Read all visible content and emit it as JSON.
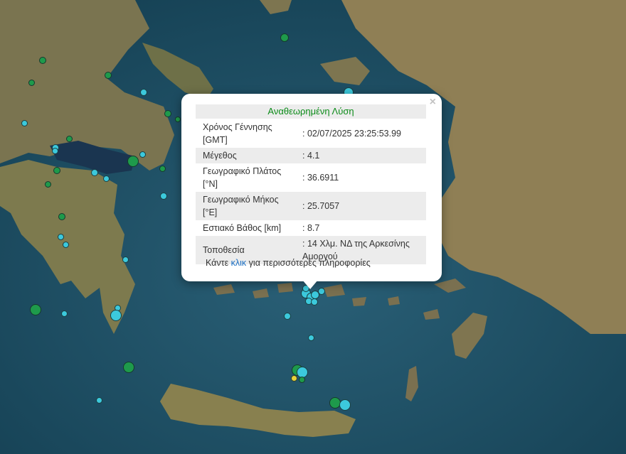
{
  "popup": {
    "header": "Αναθεωρημένη Λύση",
    "close_symbol": "×",
    "rows": [
      {
        "label": "Χρόνος Γέννησης [GMT]",
        "value": ": 02/07/2025 23:25:53.99"
      },
      {
        "label": "Μέγεθος",
        "value": ": 4.1"
      },
      {
        "label": "Γεωγραφικό Πλάτος [°N]",
        "value": ": 36.6911"
      },
      {
        "label": "Γεωγραφικό Μήκος [°E]",
        "value": ": 25.7057"
      },
      {
        "label": "Εστιακό Βάθος [km]",
        "value": ": 8.7"
      },
      {
        "label": "Τοποθεσία",
        "value": ": 14 Χλμ. ΝΔ της Αρκεσίνης Αμοργού"
      }
    ],
    "footer_before": "Κάντε ",
    "footer_link": "κλικ",
    "footer_after": " για περισσότερες πληροφορίες"
  },
  "map": {
    "sea_color": "#1f4e63",
    "land_color": "#8a7f58",
    "marker_colors": {
      "cyan": "#3cc9dc",
      "green": "#1e9a4b",
      "yellow": "#e8d23a"
    }
  }
}
